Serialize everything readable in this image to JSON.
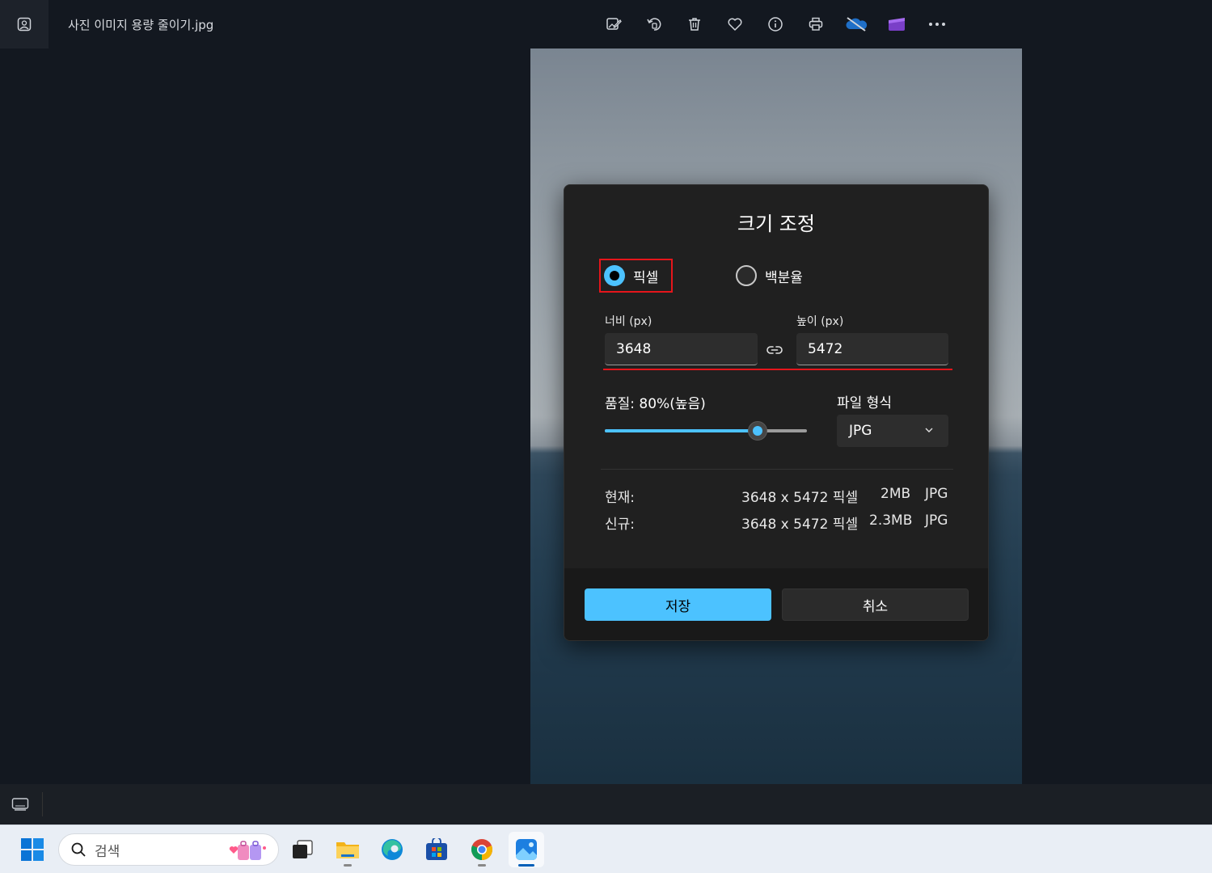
{
  "window": {
    "title": "사진 이미지 용량 줄이기.jpg"
  },
  "toolbar": {
    "icons": [
      "edit-image-icon",
      "rotate-icon",
      "delete-icon",
      "favorite-icon",
      "info-icon",
      "print-icon",
      "onedrive-icon",
      "clipchamp-icon",
      "more-icon"
    ]
  },
  "dialog": {
    "title": "크기 조정",
    "radio_pixels": "픽셀",
    "radio_percent": "백분율",
    "selected_unit": "픽셀",
    "width_label": "너비 (px)",
    "width_value": "3648",
    "height_label": "높이 (px)",
    "height_value": "5472",
    "quality_label": "품질: 80%(높음)",
    "quality_value": 80,
    "format_label": "파일 형식",
    "format_value": "JPG",
    "current_label": "현재:",
    "current_dims": "3648 x 5472 픽셀",
    "current_size": "2MB",
    "current_format": "JPG",
    "new_label": "신규:",
    "new_dims": "3648 x 5472 픽셀",
    "new_size": "2.3MB",
    "new_format": "JPG",
    "save_label": "저장",
    "cancel_label": "취소"
  },
  "taskbar": {
    "search_placeholder": "검색",
    "apps": [
      "start-icon",
      "task-view-icon",
      "file-explorer-icon",
      "edge-icon",
      "store-icon",
      "chrome-icon",
      "photos-icon"
    ]
  },
  "colors": {
    "accent": "#4cc2ff",
    "highlight": "#e5151b",
    "dialog_bg": "#202020",
    "app_bg": "#131820"
  }
}
